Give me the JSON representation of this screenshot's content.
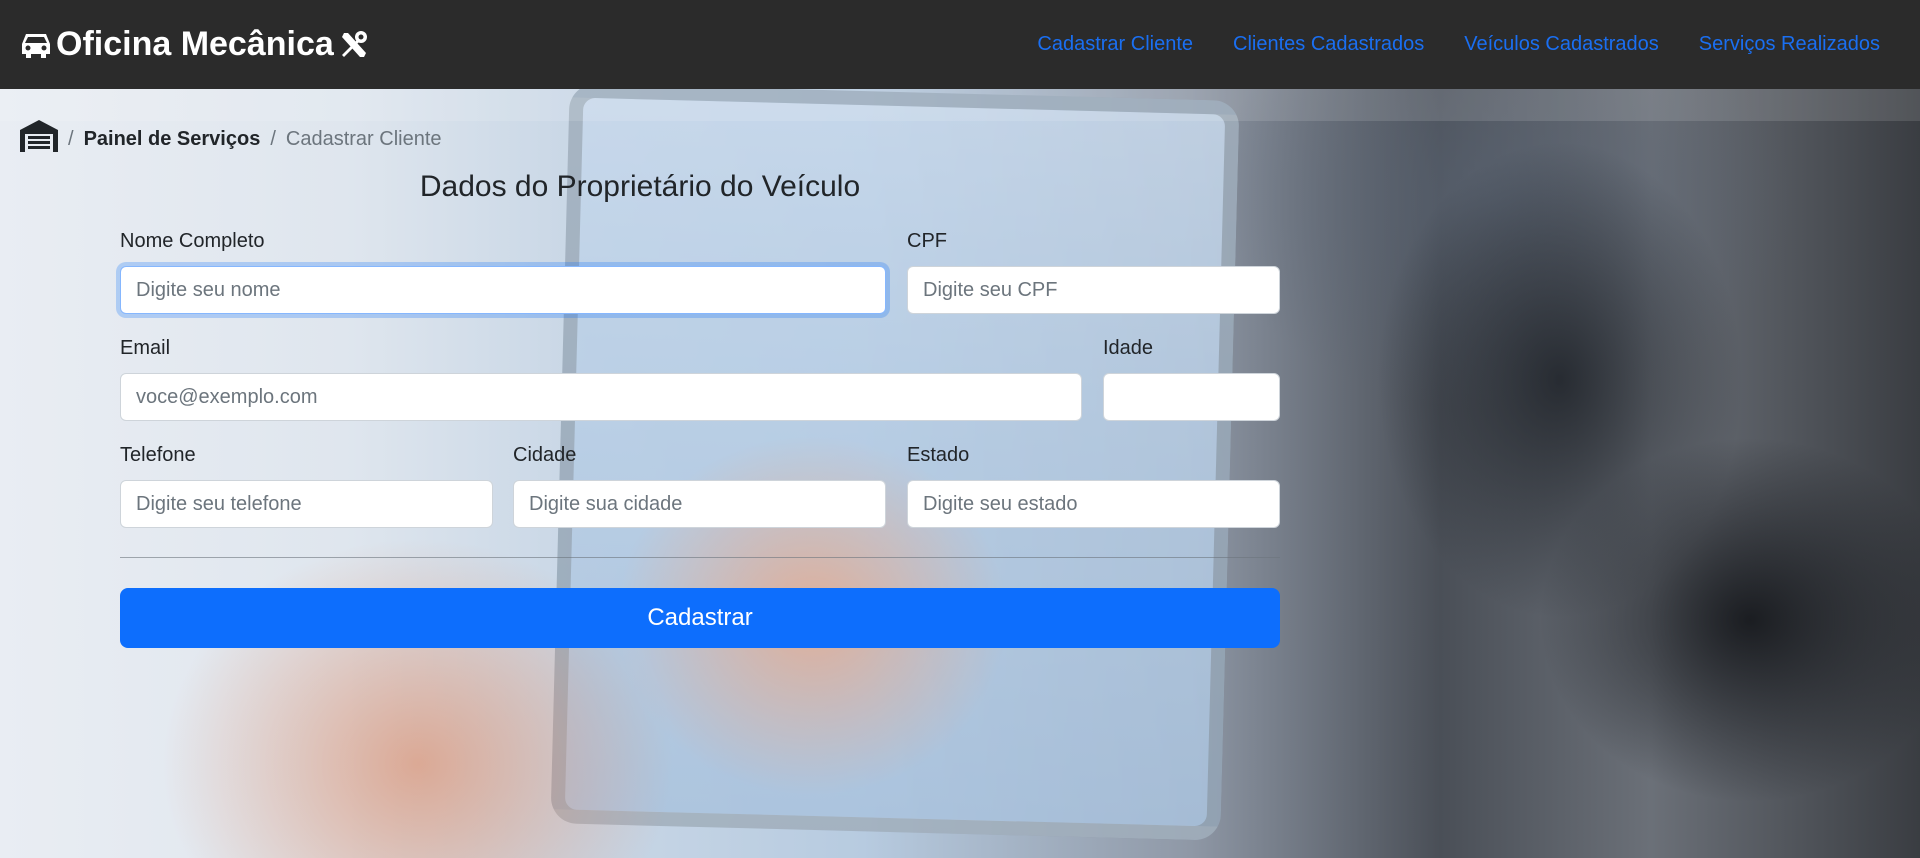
{
  "navbar": {
    "brand": "Oficina Mecânica",
    "icons": [
      "car-icon",
      "tools-icon"
    ],
    "links": [
      {
        "label": "Cadastrar Cliente"
      },
      {
        "label": "Clientes Cadastrados"
      },
      {
        "label": "Veículos Cadastrados"
      },
      {
        "label": "Serviços Realizados"
      }
    ]
  },
  "breadcrumb": {
    "home_icon": "garage-icon",
    "separator": "/",
    "items": [
      "Painel de Serviços",
      "Cadastrar Cliente"
    ]
  },
  "form": {
    "title": "Dados do Proprietário do Veículo",
    "fields": {
      "nome": {
        "label": "Nome Completo",
        "placeholder": "Digite seu nome",
        "value": ""
      },
      "cpf": {
        "label": "CPF",
        "placeholder": "Digite seu CPF",
        "value": ""
      },
      "email": {
        "label": "Email",
        "placeholder": "voce@exemplo.com",
        "value": ""
      },
      "idade": {
        "label": "Idade",
        "placeholder": "",
        "value": ""
      },
      "telefone": {
        "label": "Telefone",
        "placeholder": "Digite seu telefone",
        "value": ""
      },
      "cidade": {
        "label": "Cidade",
        "placeholder": "Digite sua cidade",
        "value": ""
      },
      "estado": {
        "label": "Estado",
        "placeholder": "Digite seu estado",
        "value": ""
      }
    },
    "submit_label": "Cadastrar"
  },
  "colors": {
    "navbar_bg": "#2b2b2b",
    "link": "#1a6ff2",
    "primary": "#0d6efd"
  }
}
